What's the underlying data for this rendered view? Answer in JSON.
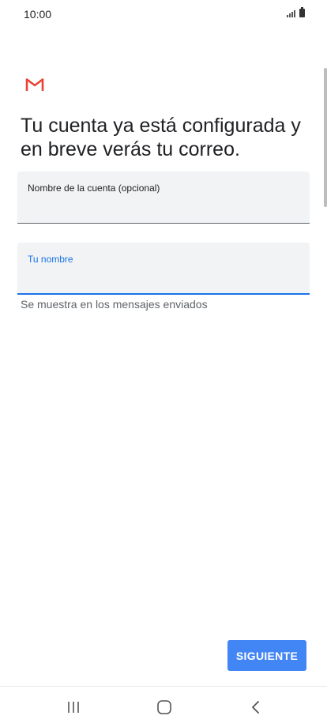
{
  "status_bar": {
    "time": "10:00",
    "icons": [
      "signal-icon",
      "battery-icon"
    ]
  },
  "app": {
    "logo": "gmail-logo"
  },
  "heading": "Tu cuenta ya está configurada y en breve verás tu correo.",
  "fields": {
    "account_name": {
      "label": "Nombre de la cuenta (opcional)",
      "value": ""
    },
    "your_name": {
      "label": "Tu nombre",
      "value": "",
      "helper": "Se muestra en los mensajes enviados"
    }
  },
  "actions": {
    "next_label": "SIGUIENTE"
  },
  "colors": {
    "accent": "#1a73e8",
    "button": "#4285f4",
    "field_bg": "#f1f3f4",
    "gmail_red": "#ea4335"
  },
  "navigation": {
    "icons": [
      "recents-icon",
      "home-icon",
      "back-icon"
    ]
  }
}
